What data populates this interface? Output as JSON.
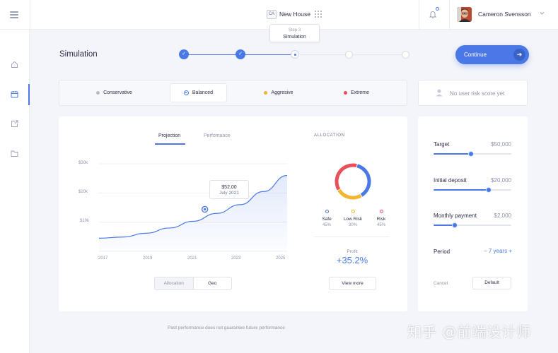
{
  "header": {
    "project_badge": "CA",
    "project_name": "New House",
    "user_name": "Cameron Svensson"
  },
  "stepper": {
    "tooltip_step": "Step 3",
    "tooltip_name": "Simulation",
    "current_step": 3,
    "total_steps": 5
  },
  "page": {
    "title": "Simulation",
    "continue_label": "Continue",
    "continue_arrow": "➔",
    "footnote": "Past performance does not guarantee future performance"
  },
  "risk": {
    "options": [
      {
        "label": "Conservative",
        "color": "#b8bcc9"
      },
      {
        "label": "Balanced",
        "color": "#4a78e6"
      },
      {
        "label": "Aggresive",
        "color": "#f2b632"
      },
      {
        "label": "Extreme",
        "color": "#e8505b"
      }
    ],
    "selected": "Balanced",
    "score_text": "No user risk score yet"
  },
  "tabs": {
    "projection": "Projection",
    "performance": "Perfomance",
    "active": "Projection"
  },
  "chart_data": {
    "type": "area",
    "x_ticks": [
      "2017",
      "2019",
      "2021",
      "2023",
      "2025"
    ],
    "y_ticks": [
      "$30k",
      "$20k",
      "$10k"
    ],
    "ylim": [
      0,
      30000
    ],
    "x": [
      2017,
      2018,
      2019,
      2020,
      2021,
      2022,
      2023,
      2024,
      2025
    ],
    "y": [
      4500,
      4900,
      6200,
      8000,
      10300,
      13000,
      16000,
      20500,
      26000
    ],
    "highlight": {
      "value": "$52,00",
      "date": "July 2021"
    },
    "grid": true
  },
  "chart_toggle": {
    "allocation": "Allocation",
    "geo": "Geo"
  },
  "allocation": {
    "title": "ALLOCATION",
    "items": [
      {
        "name": "Safe",
        "percent": "45%",
        "value": 45,
        "color": "#4a78e6"
      },
      {
        "name": "Low Risk",
        "percent": "30%",
        "value": 30,
        "color": "#f2b632"
      },
      {
        "name": "Risk",
        "percent": "45%",
        "value": 45,
        "color": "#e8505b"
      }
    ],
    "profit_label": "Profit",
    "profit_value": "+35.2%",
    "view_more": "View more"
  },
  "settings": {
    "target_label": "Target",
    "target_value": "$50,000",
    "target_fraction": 0.48,
    "deposit_label": "Initial deposit",
    "deposit_value": "$20,000",
    "deposit_fraction": 0.71,
    "monthly_label": "Monthly payment",
    "monthly_value": "$2,000",
    "monthly_fraction": 0.27,
    "period_label": "Period",
    "period_minus": "−",
    "period_value": "7 years",
    "period_plus": "+",
    "cancel": "Cancel",
    "default": "Default"
  },
  "watermark": "知乎 @前端设计师"
}
